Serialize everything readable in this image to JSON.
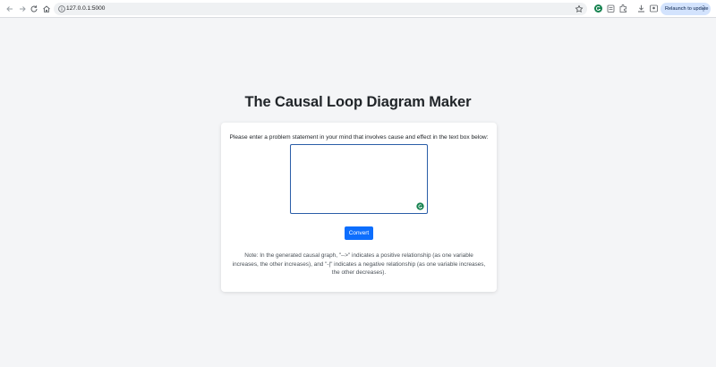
{
  "browser": {
    "url": "127.0.0.1:5000",
    "relaunch_label": "Relaunch to update",
    "menu_glyph": "⋮",
    "icons": [
      "back-arrow-icon",
      "forward-arrow-icon",
      "reload-icon",
      "home-icon",
      "site-info-icon",
      "bookmark-star-icon",
      "grammarly-extension-icon",
      "extension-icon",
      "extensions-puzzle-icon",
      "download-icon",
      "profile-icon"
    ]
  },
  "page": {
    "title": "The Causal Loop Diagram Maker",
    "prompt": "Please enter a problem statement in your mind that involves cause and effect in the text box below:",
    "textarea_value": "",
    "convert_label": "Convert",
    "note": "Note: In the generated causal graph, \"-->\" indicates a positive relationship (as one variable increases, the other increases), and \"-|\" indicates a negative relationship (as one variable increases, the other decreases)."
  },
  "colors": {
    "accent": "#0d6efd",
    "textarea_border": "#2b5ea8",
    "grammarly": "#15c39a",
    "relaunch_bg": "#d3e3fd"
  }
}
